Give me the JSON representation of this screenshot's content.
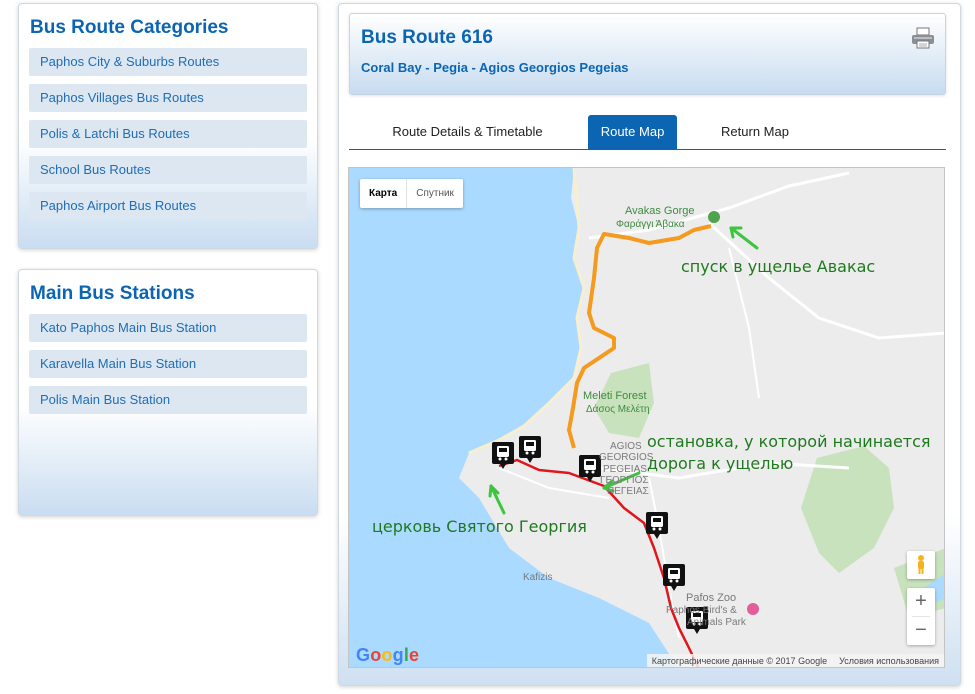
{
  "sidebar": {
    "categories_title": "Bus Route Categories",
    "categories": [
      {
        "label": "Paphos City & Suburbs Routes"
      },
      {
        "label": "Paphos Villages Bus Routes"
      },
      {
        "label": "Polis & Latchi Bus Routes"
      },
      {
        "label": "School Bus Routes"
      },
      {
        "label": "Paphos Airport Bus Routes"
      }
    ],
    "stations_title": "Main Bus Stations",
    "stations": [
      {
        "label": "Kato Paphos Main Bus Station"
      },
      {
        "label": "Karavella Main Bus Station"
      },
      {
        "label": "Polis Main Bus Station"
      }
    ]
  },
  "route": {
    "title": "Bus Route 616",
    "subtitle": "Coral Bay - Pegia - Agios Georgios Pegeias",
    "print_icon": "printer-icon"
  },
  "tabs": [
    {
      "label": "Route Details & Timetable",
      "active": false
    },
    {
      "label": "Route Map",
      "active": true
    },
    {
      "label": "Return Map",
      "active": false
    }
  ],
  "map": {
    "map_type": {
      "map": "Карта",
      "satellite": "Спутник"
    },
    "zoom_in": "+",
    "zoom_out": "−",
    "logo": "Google",
    "attribution": "Картографические данные © 2017 Google",
    "terms": "Условия использования",
    "places": {
      "avakas_en": "Avakas Gorge",
      "avakas_gr": "Φαράγγι Άβακα",
      "meleti_en": "Meleti Forest",
      "meleti_gr": "Δάσος Μελέτη",
      "agios_1": "AGIOS",
      "agios_2": "GEORGIOS",
      "agios_3": "PEGEIAS",
      "agios_gr1": "ΓΕΩΡΓΙΟΣ",
      "agios_gr2": "ΠΕΓΕΙΑΣ",
      "kafizis": "Kafizis",
      "zoo": "Pafos Zoo",
      "zoo2": "Paphos Bird's &",
      "zoo3": "Animals Park"
    },
    "annotations": {
      "gorge": "спуск в ущелье Авакас",
      "stop_1": "остановка, у которой начинается",
      "stop_2": "дорога к ущелью",
      "church": "церковь Святого Георгия"
    },
    "colors": {
      "route_orange": "#f39a1f",
      "route_red": "#e0161b",
      "arrow_green": "#3ec43e"
    }
  }
}
